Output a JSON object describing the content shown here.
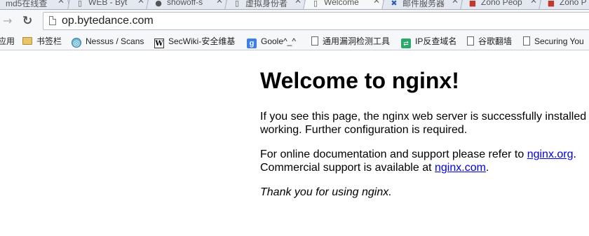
{
  "tabs": [
    {
      "title": "md5在线查",
      "icon": "document-icon",
      "active": false
    },
    {
      "title": "WEB - Byt",
      "icon": "document-icon",
      "active": false
    },
    {
      "title": "showoff-s",
      "icon": "github-icon",
      "active": false
    },
    {
      "title": "虚拟身份者",
      "icon": "document-icon",
      "active": false
    },
    {
      "title": "Welcome",
      "icon": "document-icon",
      "active": true
    },
    {
      "title": "邮件服务器",
      "icon": "tools-icon",
      "active": false
    },
    {
      "title": "Zono Peop",
      "icon": "profile-icon",
      "active": false
    },
    {
      "title": "Zono P",
      "icon": "profile-icon",
      "active": false
    }
  ],
  "toolbar": {
    "url": "op.bytedance.com"
  },
  "bookmarks": {
    "apps_label": "应用",
    "items": [
      {
        "label": "书签栏"
      },
      {
        "label": "Nessus / Scans"
      },
      {
        "label": "SecWiki-安全维基"
      },
      {
        "label": "Goole^_^"
      },
      {
        "label": "通用漏洞检测工具"
      },
      {
        "label": "IP反查域名"
      },
      {
        "label": "谷歌翻墙"
      },
      {
        "label": "Securing You"
      }
    ]
  },
  "page": {
    "heading": "Welcome to nginx!",
    "p1_line1": "If you see this page, the nginx web server is successfully installed and",
    "p1_line2": "working. Further configuration is required.",
    "p2_line1_pre": "For online documentation and support please refer to ",
    "p2_link1": "nginx.org",
    "p2_line1_post": ".",
    "p2_line2_pre": "Commercial support is available at ",
    "p2_link2": "nginx.com",
    "p2_line2_post": ".",
    "p3": "Thank you for using nginx."
  }
}
